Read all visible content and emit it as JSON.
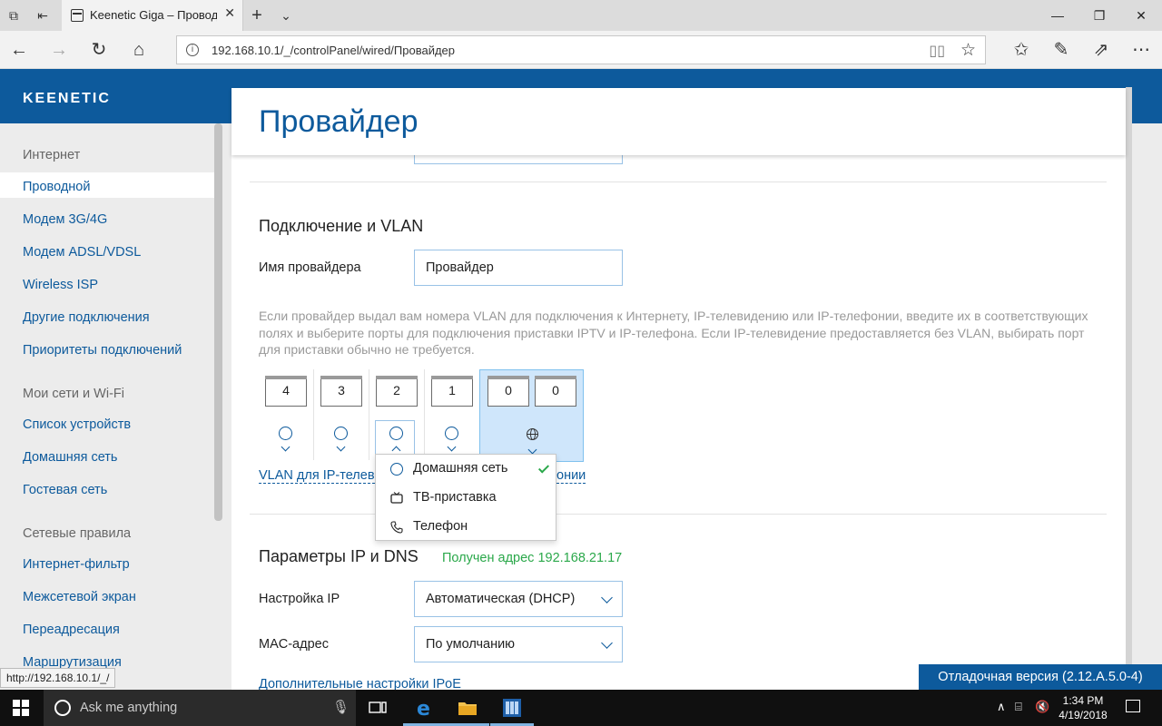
{
  "browser": {
    "tab_title": "Keenetic Giga – Провод",
    "url": "192.168.10.1/_/controlPanel/wired/Провайдер",
    "status_url": "http://192.168.10.1/_/"
  },
  "brand": {
    "logo": "KEENETIC"
  },
  "sidebar": {
    "groups": [
      {
        "title": "Интернет",
        "items": [
          "Проводной",
          "Модем 3G/4G",
          "Модем ADSL/VDSL",
          "Wireless ISP",
          "Другие подключения",
          "Приоритеты подключений"
        ]
      },
      {
        "title": "Мои сети и Wi-Fi",
        "items": [
          "Список устройств",
          "Домашняя сеть",
          "Гостевая сеть"
        ]
      },
      {
        "title": "Сетевые правила",
        "items": [
          "Интернет-фильтр",
          "Межсетевой экран",
          "Переадресация",
          "Маршрутизация"
        ]
      }
    ],
    "active_item": "Проводной"
  },
  "main": {
    "page_title": "Провайдер",
    "vlan_section": {
      "title": "Подключение и VLAN",
      "provider_label": "Имя провайдера",
      "provider_value": "Провайдер",
      "hint": "Если провайдер выдал вам номера VLAN для подключения к Интернету, IP-телевидению или IP-телефонии, введите их в соответствующих полях и выберите порты для подключения приставки IPTV и IP-телефона. Если IP-телевидение предоставляется без VLAN, выбирать порт для приставки обычно не требуется.",
      "ports": [
        "4",
        "3",
        "2",
        "1"
      ],
      "wan_ports": [
        "0",
        "0"
      ],
      "link_left": "VLAN для IP-телев",
      "link_right": "онии"
    },
    "port_menu": {
      "items": [
        {
          "label": "Домашняя сеть",
          "icon": "radio-circle-icon",
          "selected": true
        },
        {
          "label": "ТВ-приставка",
          "icon": "tv-icon",
          "selected": false
        },
        {
          "label": "Телефон",
          "icon": "phone-icon",
          "selected": false
        }
      ]
    },
    "ip_section": {
      "title": "Параметры IP и DNS",
      "status": "Получен адрес 192.168.21.17",
      "ip_label": "Настройка IP",
      "ip_value": "Автоматическая (DHCP)",
      "mac_label": "MAC-адрес",
      "mac_value": "По умолчанию",
      "more_link": "Дополнительные настройки IPoE"
    },
    "debug_badge": "Отладочная версия (2.12.A.5.0-4)"
  },
  "taskbar": {
    "search_placeholder": "Ask me anything",
    "time": "1:34 PM",
    "date": "4/19/2018"
  },
  "colors": {
    "brand_blue": "#0d5a9c",
    "ok_green": "#2aa84a",
    "wan_highlight": "#cfe6fb"
  }
}
